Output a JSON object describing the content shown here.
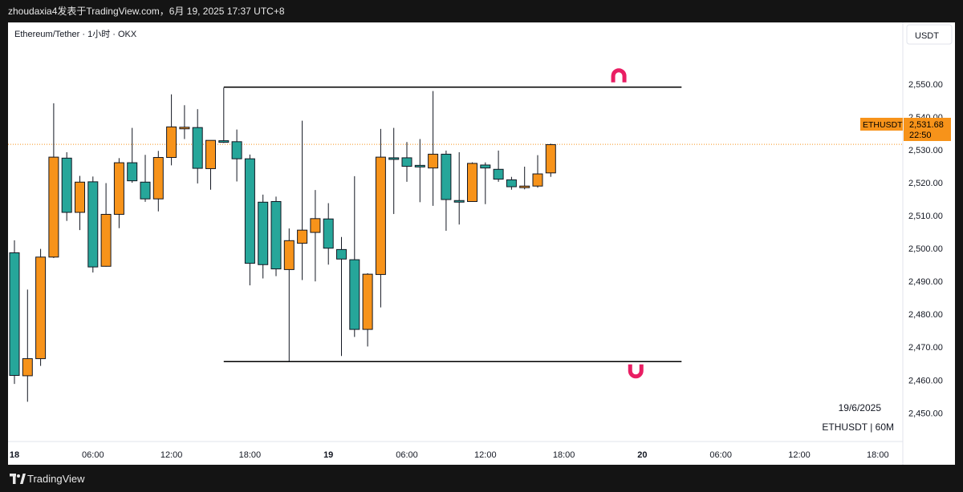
{
  "header": {
    "publish_line": "zhoudaxia4发表于TradingView.com，6月 19, 2025 17:37 UTC+8"
  },
  "footer": {
    "brand": "TradingView"
  },
  "colors": {
    "up": "#f7931a",
    "down": "#26a69a",
    "line": "#000000",
    "marker": "#e91e63",
    "price_label_bg": "#f7931a"
  },
  "chart_data": {
    "type": "candlestick",
    "title": "Ethereum/Tether · 1小时 · OKX",
    "currency": "USDT",
    "symbol": "ETHUSDT",
    "last_price_label": "2,531.68",
    "countdown": "22:50",
    "watermark_date": "19/6/2025",
    "watermark_symbol": "ETHUSDT | 60M",
    "ylim": [
      2443,
      2560
    ],
    "y_ticks": [
      2450,
      2460,
      2470,
      2480,
      2490,
      2500,
      2510,
      2520,
      2530,
      2540,
      2550
    ],
    "y_tick_labels": [
      "2,450.00",
      "2,460.00",
      "2,470.00",
      "2,480.00",
      "2,490.00",
      "2,500.00",
      "2,510.00",
      "2,520.00",
      "2,530.00",
      "2,540.00",
      "2,550.00"
    ],
    "x_ticks": [
      {
        "label": "18",
        "hour": 0,
        "bold": true
      },
      {
        "label": "06:00",
        "hour": 6,
        "bold": false
      },
      {
        "label": "12:00",
        "hour": 12,
        "bold": false
      },
      {
        "label": "18:00",
        "hour": 18,
        "bold": false
      },
      {
        "label": "19",
        "hour": 24,
        "bold": true
      },
      {
        "label": "06:00",
        "hour": 30,
        "bold": false
      },
      {
        "label": "12:00",
        "hour": 36,
        "bold": false
      },
      {
        "label": "18:00",
        "hour": 42,
        "bold": false
      },
      {
        "label": "20",
        "hour": 48,
        "bold": true
      },
      {
        "label": "06:00",
        "hour": 54,
        "bold": false
      },
      {
        "label": "12:00",
        "hour": 60,
        "bold": false
      },
      {
        "label": "18:00",
        "hour": 66,
        "bold": false
      }
    ],
    "candles": [
      {
        "h": 0,
        "o": 2498.7,
        "hi": 2502.5,
        "l": 2458.8,
        "c": 2461.4
      },
      {
        "h": 1,
        "o": 2461.3,
        "hi": 2487.5,
        "l": 2453.4,
        "c": 2466.5
      },
      {
        "h": 2,
        "o": 2466.5,
        "hi": 2499.9,
        "l": 2464.3,
        "c": 2497.4
      },
      {
        "h": 3,
        "o": 2497.4,
        "hi": 2544.2,
        "l": 2497.1,
        "c": 2527.8
      },
      {
        "h": 4,
        "o": 2527.5,
        "hi": 2529.3,
        "l": 2508.4,
        "c": 2511.0
      },
      {
        "h": 5,
        "o": 2511.0,
        "hi": 2522.1,
        "l": 2505.6,
        "c": 2520.2
      },
      {
        "h": 6,
        "o": 2520.3,
        "hi": 2521.9,
        "l": 2492.7,
        "c": 2494.4
      },
      {
        "h": 7,
        "o": 2494.6,
        "hi": 2519.9,
        "l": 2494.5,
        "c": 2510.4
      },
      {
        "h": 8,
        "o": 2510.4,
        "hi": 2527.5,
        "l": 2506.2,
        "c": 2526.1
      },
      {
        "h": 9,
        "o": 2526.1,
        "hi": 2536.7,
        "l": 2520.0,
        "c": 2520.6
      },
      {
        "h": 10,
        "o": 2520.2,
        "hi": 2528.5,
        "l": 2514.2,
        "c": 2515.1
      },
      {
        "h": 11,
        "o": 2515.1,
        "hi": 2529.7,
        "l": 2511.3,
        "c": 2527.7
      },
      {
        "h": 12,
        "o": 2527.7,
        "hi": 2546.9,
        "l": 2525.3,
        "c": 2537.0
      },
      {
        "h": 13,
        "o": 2536.5,
        "hi": 2543.6,
        "l": 2533.3,
        "c": 2536.9
      },
      {
        "h": 14,
        "o": 2536.8,
        "hi": 2542.4,
        "l": 2519.8,
        "c": 2524.4
      },
      {
        "h": 15,
        "o": 2524.3,
        "hi": 2532.9,
        "l": 2517.9,
        "c": 2532.9
      },
      {
        "h": 16,
        "o": 2532.8,
        "hi": 2548.9,
        "l": 2532.1,
        "c": 2532.4
      },
      {
        "h": 17,
        "o": 2532.5,
        "hi": 2536.2,
        "l": 2520.4,
        "c": 2527.3
      },
      {
        "h": 18,
        "o": 2527.3,
        "hi": 2528.6,
        "l": 2488.8,
        "c": 2495.5
      },
      {
        "h": 19,
        "o": 2514.1,
        "hi": 2516.4,
        "l": 2490.9,
        "c": 2495.1
      },
      {
        "h": 20,
        "o": 2514.3,
        "hi": 2515.8,
        "l": 2491.6,
        "c": 2493.8
      },
      {
        "h": 21,
        "o": 2493.6,
        "hi": 2506.1,
        "l": 2465.6,
        "c": 2502.4
      },
      {
        "h": 22,
        "o": 2501.6,
        "hi": 2538.9,
        "l": 2490.4,
        "c": 2505.6
      },
      {
        "h": 23,
        "o": 2504.9,
        "hi": 2517.8,
        "l": 2490.0,
        "c": 2509.1
      },
      {
        "h": 24,
        "o": 2509.0,
        "hi": 2513.8,
        "l": 2495.1,
        "c": 2500.1
      },
      {
        "h": 25,
        "o": 2499.7,
        "hi": 2503.5,
        "l": 2467.3,
        "c": 2496.8
      },
      {
        "h": 26,
        "o": 2496.6,
        "hi": 2522.0,
        "l": 2473.1,
        "c": 2475.4
      },
      {
        "h": 27,
        "o": 2475.4,
        "hi": 2492.5,
        "l": 2470.2,
        "c": 2492.2
      },
      {
        "h": 28,
        "o": 2492.1,
        "hi": 2536.4,
        "l": 2482.1,
        "c": 2527.8
      },
      {
        "h": 29,
        "o": 2527.6,
        "hi": 2536.7,
        "l": 2510.5,
        "c": 2527.4
      },
      {
        "h": 30,
        "o": 2527.6,
        "hi": 2532.4,
        "l": 2520.3,
        "c": 2525.0
      },
      {
        "h": 31,
        "o": 2525.3,
        "hi": 2533.3,
        "l": 2514.1,
        "c": 2525.0
      },
      {
        "h": 32,
        "o": 2524.5,
        "hi": 2547.9,
        "l": 2513.0,
        "c": 2528.7
      },
      {
        "h": 33,
        "o": 2528.7,
        "hi": 2529.8,
        "l": 2505.4,
        "c": 2514.9
      },
      {
        "h": 34,
        "o": 2514.6,
        "hi": 2529.3,
        "l": 2507.3,
        "c": 2514.4
      },
      {
        "h": 35,
        "o": 2514.3,
        "hi": 2526.2,
        "l": 2514.2,
        "c": 2525.9
      },
      {
        "h": 36,
        "o": 2525.4,
        "hi": 2526.2,
        "l": 2513.5,
        "c": 2524.5
      },
      {
        "h": 37,
        "o": 2524.1,
        "hi": 2529.8,
        "l": 2520.3,
        "c": 2521.1
      },
      {
        "h": 38,
        "o": 2520.9,
        "hi": 2521.8,
        "l": 2517.9,
        "c": 2518.8
      },
      {
        "h": 39,
        "o": 2518.9,
        "hi": 2524.9,
        "l": 2518.0,
        "c": 2519.0
      },
      {
        "h": 40,
        "o": 2519.0,
        "hi": 2528.4,
        "l": 2518.5,
        "c": 2522.7
      },
      {
        "h": 41,
        "o": 2523.0,
        "hi": 2531.9,
        "l": 2521.8,
        "c": 2531.6
      }
    ],
    "levels": [
      {
        "value": 2549.1,
        "from_hour": 16,
        "to_hour": 51
      },
      {
        "value": 2465.6,
        "from_hour": 16,
        "to_hour": 51
      }
    ],
    "current_price": 2531.68,
    "markers": [
      {
        "type": "arrow-up-marker",
        "hour": 46.2,
        "value": 2552.5
      },
      {
        "type": "arrow-down-marker",
        "hour": 47.5,
        "value": 2462.8
      }
    ]
  }
}
